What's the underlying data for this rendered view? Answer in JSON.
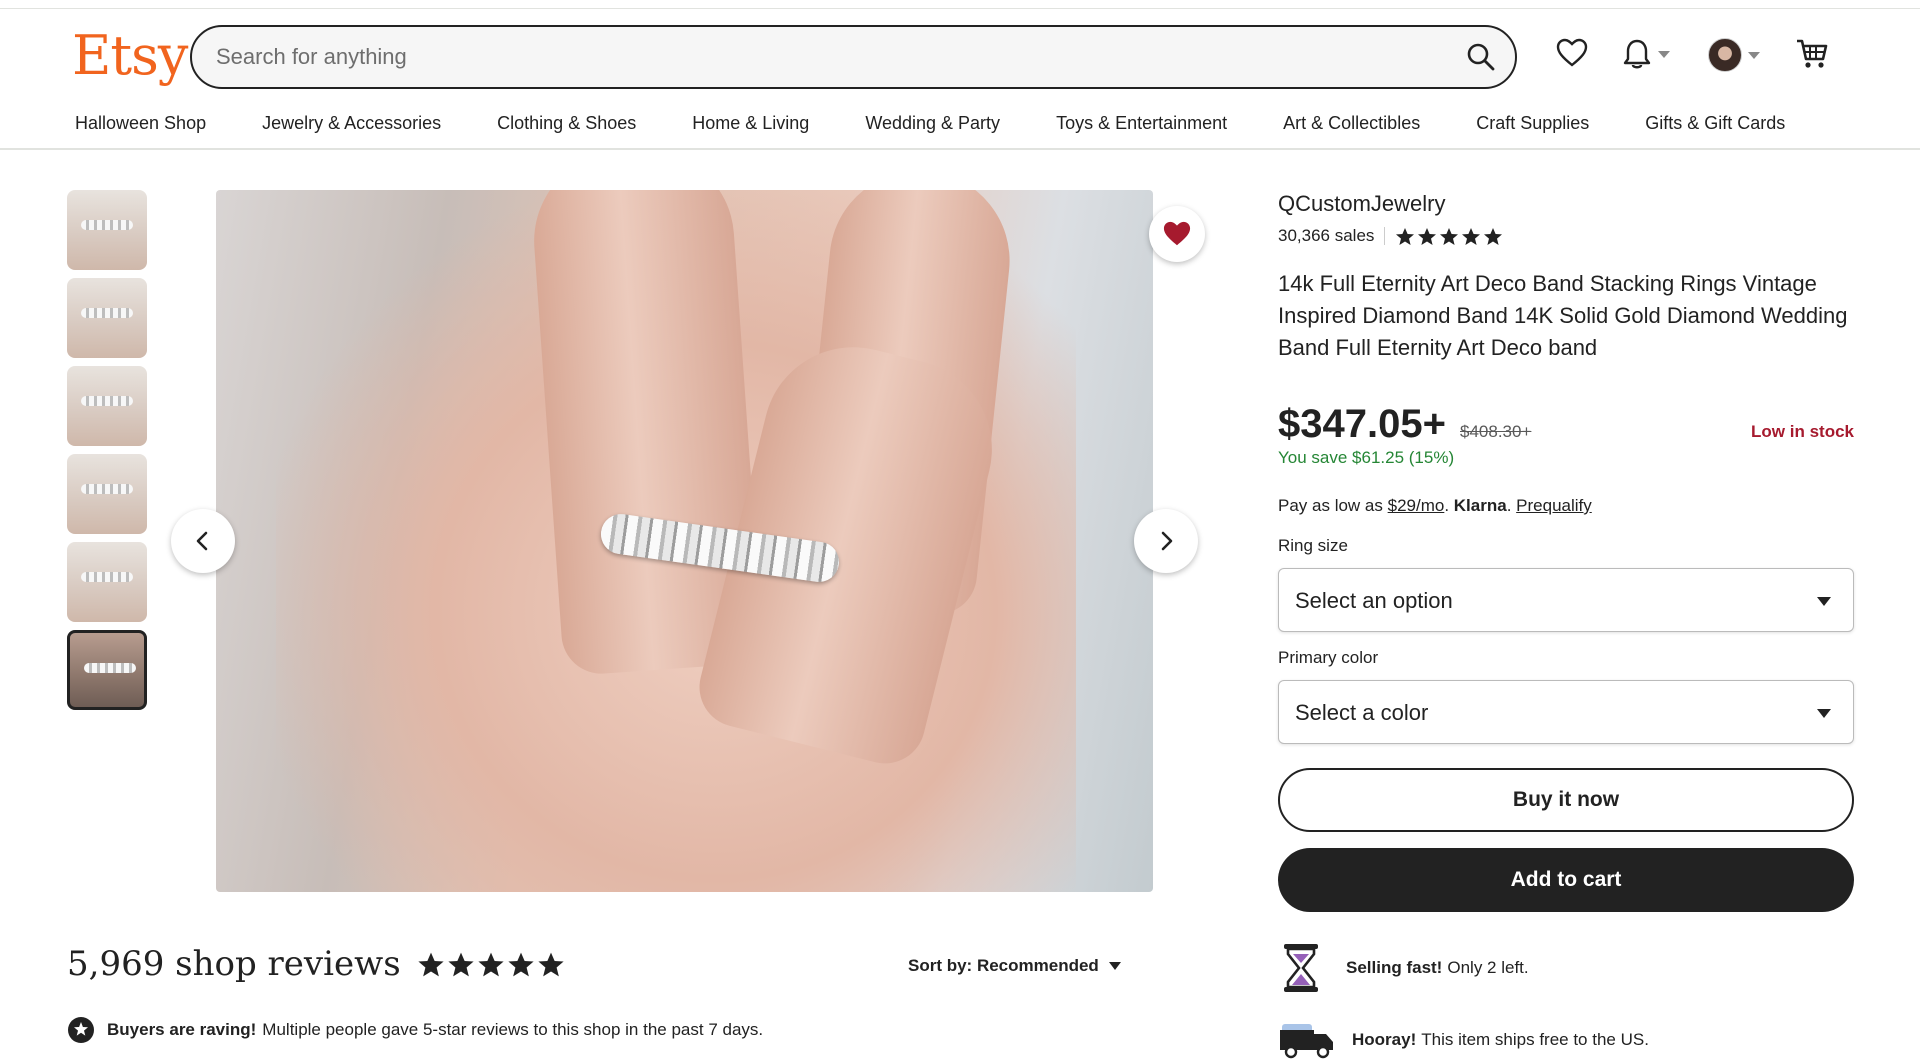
{
  "header": {
    "logo": "Etsy",
    "search_placeholder": "Search for anything"
  },
  "categories": [
    "Halloween Shop",
    "Jewelry & Accessories",
    "Clothing & Shoes",
    "Home & Living",
    "Wedding & Party",
    "Toys & Entertainment",
    "Art & Collectibles",
    "Craft Supplies",
    "Gifts & Gift Cards"
  ],
  "gallery": {
    "thumbnail_count": 6,
    "active_thumbnail": 6
  },
  "listing": {
    "shop_name": "QCustomJewelry",
    "sales": "30,366 sales",
    "rating_stars": 5,
    "title": "14k Full Eternity Art Deco Band Stacking Rings Vintage Inspired Diamond Band 14K Solid Gold Diamond Wedding Band Full Eternity Art Deco band",
    "price": "$347.05+",
    "original_price": "$408.30+",
    "stock_status": "Low in stock",
    "savings": "You save $61.25 (15%)",
    "klarna": {
      "prefix": "Pay as low as",
      "amount": "$29/mo",
      "brand": "Klarna",
      "link": "Prequalify"
    },
    "ring_size": {
      "label": "Ring size",
      "value": "Select an option"
    },
    "primary_color": {
      "label": "Primary color",
      "value": "Select a color"
    },
    "buy_now": "Buy it now",
    "add_to_cart": "Add to cart",
    "selling_fast": {
      "bold": "Selling fast!",
      "text": "Only 2 left."
    },
    "shipping": {
      "bold": "Hooray!",
      "text": "This item ships free to the US."
    }
  },
  "reviews": {
    "title": "5,969 shop reviews",
    "rating_stars": 5,
    "sort_label": "Sort by: Recommended",
    "raving_bold": "Buyers are raving!",
    "raving_text": "Multiple people gave 5-star reviews to this shop in the past 7 days."
  },
  "colors": {
    "brand": "#f1641e",
    "price_save": "#258635",
    "low_stock": "#a61a2e",
    "favorite": "#a61a2e"
  }
}
